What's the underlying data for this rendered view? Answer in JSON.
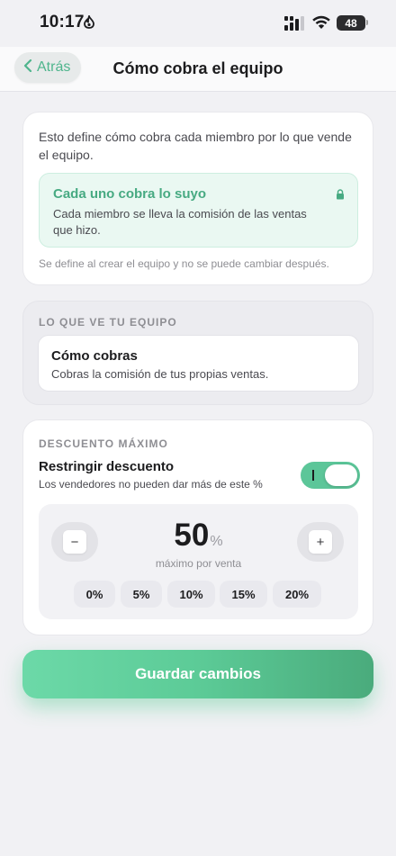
{
  "status_bar": {
    "time": "10:17",
    "battery": "48"
  },
  "nav": {
    "back_label": "Atrás",
    "title": "Cómo cobra el equipo"
  },
  "commission": {
    "description": "Esto define cómo cobra cada miembro por lo que vende el equipo.",
    "mode_title": "Cada uno cobra lo suyo",
    "mode_subtitle": "Cada miembro se lleva la comisión de las ventas que hizo.",
    "note": "Se define al crear el equipo y no se puede cambiar después."
  },
  "team_view": {
    "section_label": "LO QUE VE TU EQUIPO",
    "title": "Cómo cobras",
    "subtitle": "Cobras la comisión de tus propias ventas."
  },
  "discount": {
    "section_label": "DESCUENTO MÁXIMO",
    "restrict_title": "Restringir descuento",
    "restrict_subtitle": "Los vendedores no pueden dar más de este %",
    "toggle_on": true,
    "value": "50",
    "unit": "%",
    "caption": "máximo por venta",
    "minus_label": "−",
    "plus_label": "+",
    "presets": [
      "0%",
      "5%",
      "10%",
      "15%",
      "20%"
    ]
  },
  "save_button": {
    "label": "Guardar cambios"
  },
  "colors": {
    "accent": "#5cc699",
    "accent_dark": "#47aa82",
    "background": "#f1f1f4"
  },
  "icons": [
    "flame-icon",
    "signal-icon",
    "wifi-icon",
    "battery-icon",
    "chevron-left-icon",
    "lock-icon"
  ]
}
